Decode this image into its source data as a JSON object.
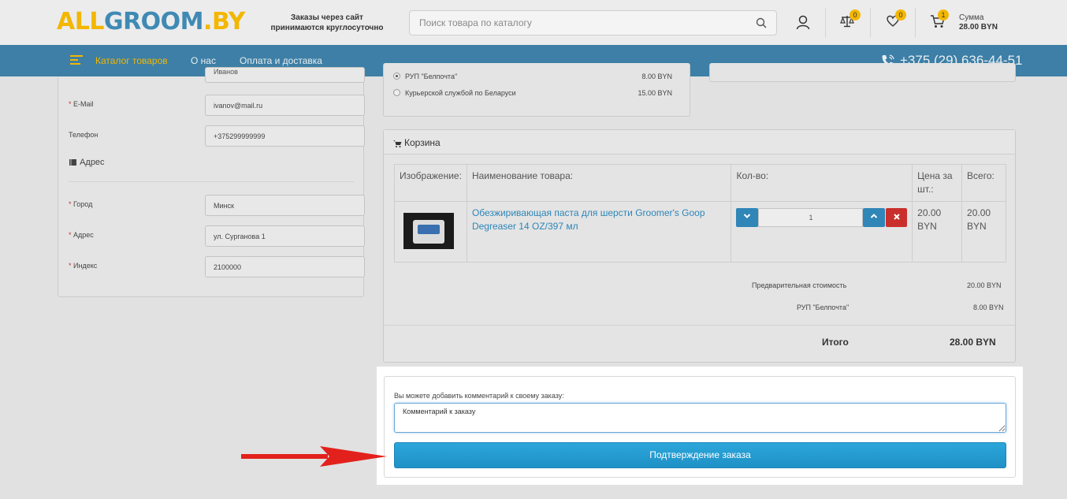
{
  "header": {
    "logo": {
      "part1": "ALL",
      "part2": "GROOM",
      "part3": ".BY"
    },
    "orders_note_line1": "Заказы через сайт",
    "orders_note_line2": "принимаются круглосуточно",
    "search_placeholder": "Поиск товара по каталогу",
    "compare_count": "0",
    "wishlist_count": "0",
    "cart_count": "1",
    "cart_sum_label": "Сумма",
    "cart_sum_value": "28.00 BYN"
  },
  "nav": {
    "catalog": "Каталог товаров",
    "about": "О нас",
    "payment": "Оплата и доставка",
    "phone": "+375 (29) 636-44-51"
  },
  "form": {
    "partial_top_value": "Иванов",
    "email_label": "E-Mail",
    "email_value": "ivanov@mail.ru",
    "phone_label": "Телефон",
    "phone_value": "+375299999999",
    "address_section": "Адрес",
    "city_label": "Город",
    "city_value": "Минск",
    "street_label": "Адрес",
    "street_value": "ул. Сурганова 1",
    "zip_label": "Индекс",
    "zip_value": "2100000"
  },
  "delivery": {
    "options": [
      {
        "label": "РУП \"Белпочта\"",
        "price": "8.00 BYN",
        "selected": true
      },
      {
        "label": "Курьерской службой по Беларуси",
        "price": "15.00 BYN",
        "selected": false
      }
    ]
  },
  "cart": {
    "title": "Корзина",
    "columns": [
      "Изображение:",
      "Наименование товара:",
      "Кол-во:",
      "Цена за шт.:",
      "Всего:"
    ],
    "items": [
      {
        "name": "Обезжиривающая паста для шерсти Groomer's Goop Degreaser 14 OZ/397 мл",
        "quantity": "1",
        "price": "20.00 BYN",
        "total": "20.00 BYN"
      }
    ],
    "subtotal_label": "Предварительная стоимость",
    "subtotal_value": "20.00 BYN",
    "shipping_label": "РУП \"Белпочта\"",
    "shipping_value": "8.00 BYN",
    "grand_label": "Итого",
    "grand_value": "28.00 BYN"
  },
  "confirm": {
    "comment_label": "Вы можете добавить комментарий к своему заказу:",
    "comment_value": "Комментарий к заказу",
    "button_label": "Подтверждение заказа"
  },
  "colors": {
    "brand_yellow": "#f3b700",
    "brand_blue": "#3d7fa6",
    "button_blue": "#2ba6db",
    "delete_red": "#c9302c",
    "arrow_red": "#e3211c"
  }
}
